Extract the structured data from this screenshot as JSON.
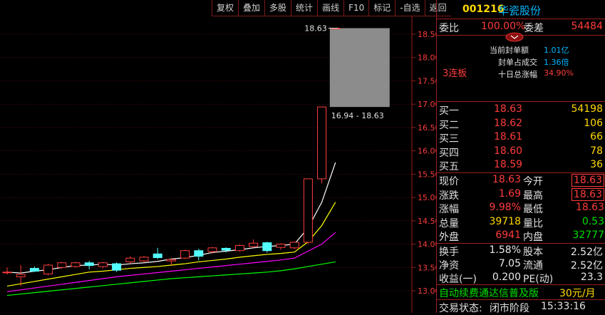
{
  "toolbar": [
    "复权",
    "叠加",
    "多股",
    "统计",
    "画线",
    "F10",
    "标记",
    "-自选",
    "返回"
  ],
  "stock": {
    "code": "001216",
    "name": "华瓷股份"
  },
  "weibi": {
    "label1": "委比",
    "value1": "100.00%",
    "label2": "委差",
    "value2": "54484"
  },
  "seal": {
    "streak": "3连板",
    "items": [
      {
        "label": "当前封单额",
        "value": "1.01亿"
      },
      {
        "label": "封单占成交",
        "value": "1.36倍"
      },
      {
        "label": "十日总涨幅",
        "value": "34.90%"
      }
    ]
  },
  "bids": [
    {
      "label": "买一",
      "price": "18.63",
      "vol": "54198"
    },
    {
      "label": "买二",
      "price": "18.62",
      "vol": "106"
    },
    {
      "label": "买三",
      "price": "18.61",
      "vol": "66"
    },
    {
      "label": "买四",
      "price": "18.60",
      "vol": "78"
    },
    {
      "label": "买五",
      "price": "18.59",
      "vol": "36"
    }
  ],
  "quote": [
    {
      "l1": "现价",
      "v1": "18.63",
      "l2": "今开",
      "v2": "18.63"
    },
    {
      "l1": "涨跌",
      "v1": "1.69",
      "l2": "最高",
      "v2": "18.63"
    },
    {
      "l1": "涨幅",
      "v1": "9.98%",
      "l2": "最低",
      "v2": "18.63"
    },
    {
      "l1": "总量",
      "v1": "39718",
      "l2": "量比",
      "v2": "0.53"
    },
    {
      "l1": "外盘",
      "v1": "6941",
      "l2": "内盘",
      "v2": "32777"
    }
  ],
  "fund": [
    {
      "l1": "换手",
      "v1": "1.58%",
      "l2": "股本",
      "v2": "2.52亿"
    },
    {
      "l1": "净资",
      "v1": "7.05",
      "l2": "流通",
      "v2": "2.52亿"
    },
    {
      "l1": "收益(一)",
      "v1": "0.200",
      "l2": "PE(动)",
      "v2": "23.3"
    }
  ],
  "promo": {
    "text": "自动续费通达信普及版",
    "price": "30元/月"
  },
  "status": {
    "label": "交易状态:",
    "value": "闭市阶段",
    "time": "15:33:16"
  },
  "colors": {
    "up": "#ff3c3c",
    "down": "#54ffff",
    "ma5": "#ffffff",
    "ma10": "#ffff00",
    "ma20": "#ff00ff",
    "ma60": "#00ff00",
    "grid": "#9c1e1e"
  },
  "chart_data": {
    "type": "candlestick",
    "y_axis": {
      "min": 13.0,
      "max": 18.5,
      "ticks": [
        "18.50",
        "18.00",
        "17.50",
        "17.00",
        "16.50",
        "16.00",
        "15.50",
        "15.00",
        "14.50",
        "14.00",
        "13.50",
        "13.00"
      ]
    },
    "annotations": [
      "18.63",
      "16.94 - 18.63"
    ],
    "candles": [
      {
        "o": 13.4,
        "c": 13.4,
        "h": 13.5,
        "l": 13.35
      },
      {
        "o": 13.3,
        "c": 13.35,
        "h": 13.55,
        "l": 13.1
      },
      {
        "o": 13.48,
        "c": 13.42,
        "h": 13.52,
        "l": 13.4
      },
      {
        "o": 13.36,
        "c": 13.55,
        "h": 13.58,
        "l": 13.33
      },
      {
        "o": 13.5,
        "c": 13.6,
        "h": 13.62,
        "l": 13.47
      },
      {
        "o": 13.52,
        "c": 13.6,
        "h": 13.62,
        "l": 13.5
      },
      {
        "o": 13.6,
        "c": 13.54,
        "h": 13.64,
        "l": 13.46
      },
      {
        "o": 13.52,
        "c": 13.6,
        "h": 13.62,
        "l": 13.48
      },
      {
        "o": 13.58,
        "c": 13.44,
        "h": 13.61,
        "l": 13.4
      },
      {
        "o": 13.62,
        "c": 13.7,
        "h": 13.74,
        "l": 13.58
      },
      {
        "o": 13.64,
        "c": 13.72,
        "h": 13.75,
        "l": 13.6
      },
      {
        "o": 13.79,
        "c": 13.71,
        "h": 13.92,
        "l": 13.68
      },
      {
        "o": 13.64,
        "c": 13.67,
        "h": 13.7,
        "l": 13.55
      },
      {
        "o": 13.7,
        "c": 13.86,
        "h": 13.88,
        "l": 13.68
      },
      {
        "o": 13.86,
        "c": 13.74,
        "h": 13.9,
        "l": 13.65
      },
      {
        "o": 13.84,
        "c": 13.92,
        "h": 13.94,
        "l": 13.8
      },
      {
        "o": 13.91,
        "c": 13.87,
        "h": 13.93,
        "l": 13.82
      },
      {
        "o": 13.86,
        "c": 13.97,
        "h": 13.99,
        "l": 13.84
      },
      {
        "o": 13.95,
        "c": 14.02,
        "h": 14.1,
        "l": 13.92
      },
      {
        "o": 14.03,
        "c": 13.86,
        "h": 14.05,
        "l": 13.82
      },
      {
        "o": 13.93,
        "c": 14.0,
        "h": 14.02,
        "l": 13.88
      },
      {
        "o": 13.92,
        "c": 14.04,
        "h": 14.06,
        "l": 13.89
      },
      {
        "o": 14.04,
        "c": 15.4,
        "h": 15.4,
        "l": 14.0
      },
      {
        "o": 15.4,
        "c": 16.94,
        "h": 16.94,
        "l": 15.3
      },
      {
        "o": 18.63,
        "c": 18.63,
        "h": 18.63,
        "l": 18.63
      }
    ],
    "ma5": [
      13.4,
      13.38,
      13.42,
      13.45,
      13.5,
      13.54,
      13.55,
      13.57,
      13.55,
      13.58,
      13.6,
      13.63,
      13.68,
      13.71,
      13.76,
      13.82,
      13.85,
      13.88,
      13.92,
      13.95,
      13.97,
      14.0,
      14.35,
      14.9,
      15.75
    ],
    "ma10": [
      13.1,
      13.15,
      13.2,
      13.25,
      13.3,
      13.35,
      13.4,
      13.42,
      13.45,
      13.48,
      13.5,
      13.52,
      13.55,
      13.58,
      13.62,
      13.65,
      13.68,
      13.72,
      13.75,
      13.78,
      13.8,
      13.83,
      14.05,
      14.4,
      14.9
    ],
    "ma20": [
      12.98,
      13.02,
      13.06,
      13.1,
      13.14,
      13.18,
      13.22,
      13.26,
      13.3,
      13.33,
      13.36,
      13.39,
      13.42,
      13.45,
      13.48,
      13.51,
      13.54,
      13.57,
      13.6,
      13.63,
      13.66,
      13.7,
      13.85,
      14.0,
      14.25
    ],
    "ma60": [
      12.9,
      12.93,
      12.96,
      12.99,
      13.02,
      13.05,
      13.08,
      13.11,
      13.14,
      13.17,
      13.2,
      13.23,
      13.26,
      13.28,
      13.3,
      13.32,
      13.34,
      13.36,
      13.38,
      13.4,
      13.43,
      13.47,
      13.52,
      13.57,
      13.62
    ]
  }
}
